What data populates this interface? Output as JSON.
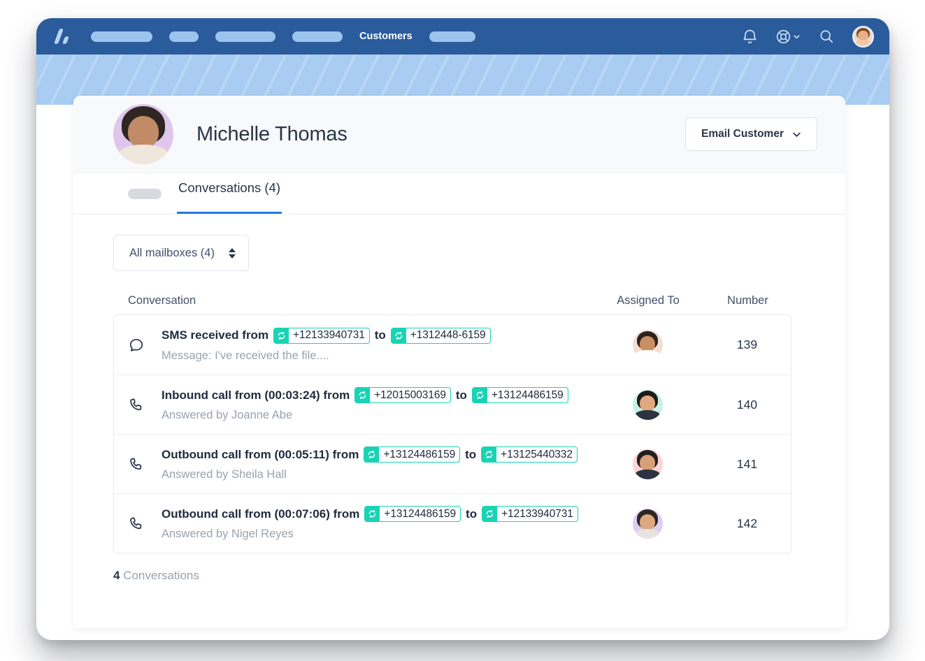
{
  "window": {
    "nav": {
      "logo_icon": "helpscout-logo-icon",
      "placeholder_pills": [
        88,
        42,
        86,
        72,
        66
      ],
      "active_label": "Customers",
      "icons": [
        {
          "name": "notifications-bell-icon",
          "glyph": "bell"
        },
        {
          "name": "help-lifebuoy-icon",
          "glyph": "lifebuoy",
          "has_chevron": true
        },
        {
          "name": "search-icon",
          "glyph": "magnifier"
        }
      ],
      "avatar": {
        "name": "user-avatar",
        "bg": "#f3d9c4",
        "hair": "#7a4a2a",
        "skin": "#e8b08a"
      }
    },
    "customer": {
      "avatar": {
        "name": "customer-avatar",
        "bg": "#dec6ec",
        "hair": "#2f2622",
        "skin": "#c08b66",
        "shirt": "#efe6dc"
      },
      "name": "Michelle Thomas",
      "action_button": {
        "label": "Email Customer",
        "chevron_icon": "chevron-down-icon"
      }
    },
    "tabs": [
      {
        "label": "Conversations (4)",
        "active": true
      }
    ],
    "filter": {
      "selected": "All mailboxes (4)",
      "stepper_icon": "stepper-up-down-icon"
    },
    "table": {
      "columns": [
        "Conversation",
        "Assigned To",
        "Number"
      ],
      "rows": [
        {
          "icon": "chat-bubble-icon",
          "prefix": "SMS received from",
          "from": "+12133940731",
          "joiner": "to",
          "to": "+1312448-6159",
          "subtitle": "Message: I've received the file....",
          "number": "139",
          "avatar": {
            "name": "assignee-avatar",
            "bg": "#f2ded2",
            "hair": "#2b2320",
            "skin": "#c98f62",
            "shirt": "#ffffff"
          }
        },
        {
          "icon": "phone-icon",
          "prefix": "Inbound call from (00:03:24) from",
          "from": "+12015003169",
          "joiner": "to",
          "to": "+13124486159",
          "subtitle": "Answered by Joanne Abe",
          "number": "140",
          "avatar": {
            "name": "assignee-avatar",
            "bg": "#c9f0e6",
            "hair": "#1d1b1a",
            "skin": "#dfa97f",
            "shirt": "#2b3440"
          }
        },
        {
          "icon": "phone-icon",
          "prefix": "Outbound call from (00:05:11) from",
          "from": "+13124486159",
          "joiner": "to",
          "to": "+13125440332",
          "subtitle": "Answered by Sheila Hall",
          "number": "141",
          "avatar": {
            "name": "assignee-avatar",
            "bg": "#fbd3d4",
            "hair": "#241e1c",
            "skin": "#d8a079",
            "shirt": "#2b3440"
          }
        },
        {
          "icon": "phone-icon",
          "prefix": "Outbound call from (00:07:06) from",
          "from": "+13124486159",
          "joiner": "to",
          "to": "+12133940731",
          "subtitle": "Answered by Nigel Reyes",
          "number": "142",
          "avatar": {
            "name": "assignee-avatar",
            "bg": "#dbcdf3",
            "hair": "#2c2722",
            "skin": "#dda87f",
            "shirt": "#e7e3de"
          }
        }
      ],
      "footer_count": "4",
      "footer_label": "Conversations"
    }
  },
  "colors": {
    "nav_bg": "#2a5b9b",
    "banner_bg": "#a8ccf2",
    "tag_accent": "#18d3b4",
    "tab_active_underline": "#1f7ce0",
    "text_primary": "#2a3548",
    "text_muted": "#9aa2ad"
  }
}
